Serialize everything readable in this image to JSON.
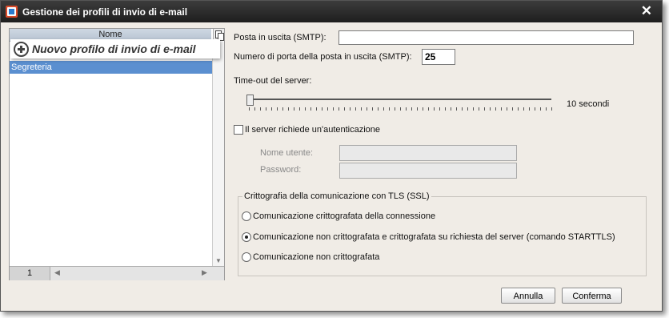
{
  "window": {
    "title": "Gestione dei profili di invio di e-mail",
    "close_glyph": "✕"
  },
  "list": {
    "header": "Nome",
    "new_profile": "Nuovo profilo di invio di e-mail",
    "items": [
      {
        "label": "Segreteria",
        "selected": true
      }
    ],
    "page": "1"
  },
  "form": {
    "smtp_label": "Posta in uscita (SMTP):",
    "smtp_value": "",
    "port_label": "Numero di porta della posta in uscita (SMTP):",
    "port_value": "25",
    "timeout_label": "Time-out del server:",
    "timeout_value_label": "10 secondi",
    "auth_label": "Il server richiede un'autenticazione",
    "auth_checked": false,
    "username_label": "Nome utente:",
    "username_value": "",
    "password_label": "Password:",
    "password_value": ""
  },
  "tls": {
    "legend": "Crittografia della comunicazione con TLS (SSL)",
    "options": [
      {
        "label": "Comunicazione crittografata della connessione",
        "selected": false
      },
      {
        "label": "Comunicazione non crittografata e crittografata su richiesta del server (comando STARTTLS)",
        "selected": true
      },
      {
        "label": "Comunicazione non crittografata",
        "selected": false
      }
    ]
  },
  "buttons": {
    "cancel": "Annulla",
    "confirm": "Conferma"
  },
  "icons": {
    "app": "app-logo-icon",
    "close": "close-icon",
    "add": "plus-circle-icon",
    "copy": "copy-icon"
  }
}
